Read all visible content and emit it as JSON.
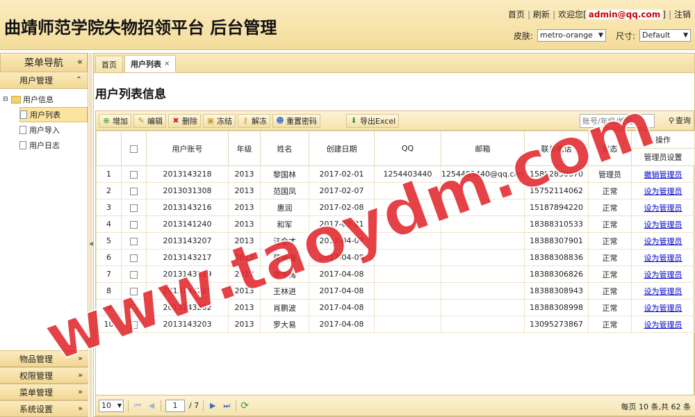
{
  "header": {
    "title": "曲靖师范学院失物招领平台 后台管理",
    "links": {
      "home": "首页",
      "refresh": "刷新",
      "welcome_prefix": "欢迎您[",
      "user": "admin@qq.com",
      "welcome_suffix": "]",
      "logout": "注销"
    },
    "skin_label": "皮肤:",
    "skin_value": "metro-orange",
    "size_label": "尺寸:",
    "size_value": "Default"
  },
  "nav": {
    "title": "菜单导航",
    "collapse_glyph": "«",
    "user_panel": "用户管理",
    "tree_root": "用户信息",
    "tree_items": [
      "用户列表",
      "用户导入",
      "用户日志"
    ],
    "other_panels": [
      "物品管理",
      "权限管理",
      "菜单管理",
      "系统设置"
    ]
  },
  "tabs": [
    {
      "label": "首页"
    },
    {
      "label": "用户列表"
    }
  ],
  "page_title": "用户列表信息",
  "toolbar": {
    "buttons": [
      "增加",
      "编辑",
      "删除",
      "冻结",
      "解冻",
      "重置密码"
    ],
    "export": "导出Excel",
    "search_placeholder": "账号/年级/姓名",
    "search": "查询"
  },
  "columns": [
    "",
    "用户账号",
    "年级",
    "姓名",
    "创建日期",
    "QQ",
    "邮箱",
    "联系电话",
    "状态"
  ],
  "op_header": "操作",
  "op_subheader": "管理员设置",
  "rows": [
    {
      "n": "1",
      "account": "2013143218",
      "grade": "2013",
      "name": "黎国林",
      "date": "2017-02-01",
      "qq": "1254403440",
      "email": "1254403440@qq.com",
      "phone": "15802850670",
      "status": "管理员",
      "op": "撤销管理员"
    },
    {
      "n": "2",
      "account": "2013031308",
      "grade": "2013",
      "name": "范国凤",
      "date": "2017-02-07",
      "qq": "",
      "email": "",
      "phone": "15752114062",
      "status": "正常",
      "op": "设为管理员"
    },
    {
      "n": "3",
      "account": "2013143216",
      "grade": "2013",
      "name": "惠润",
      "date": "2017-02-08",
      "qq": "",
      "email": "",
      "phone": "15187894220",
      "status": "正常",
      "op": "设为管理员"
    },
    {
      "n": "4",
      "account": "2013141240",
      "grade": "2013",
      "name": "和军",
      "date": "2017-03-21",
      "qq": "",
      "email": "",
      "phone": "18388310533",
      "status": "正常",
      "op": "设为管理员"
    },
    {
      "n": "5",
      "account": "2013143207",
      "grade": "2013",
      "name": "汪金才",
      "date": "2017-04-07",
      "qq": "",
      "email": "",
      "phone": "18388307901",
      "status": "正常",
      "op": "设为管理员"
    },
    {
      "n": "6",
      "account": "2013143217",
      "grade": "2013",
      "name": "蒋金海",
      "date": "2017-04-08",
      "qq": "",
      "email": "",
      "phone": "18388308836",
      "status": "正常",
      "op": "设为管理员"
    },
    {
      "n": "7",
      "account": "2013143219",
      "grade": "2013",
      "name": "李冬梅",
      "date": "2017-04-08",
      "qq": "",
      "email": "",
      "phone": "18388306826",
      "status": "正常",
      "op": "设为管理员"
    },
    {
      "n": "8",
      "account": "2013143201",
      "grade": "2013",
      "name": "王林进",
      "date": "2017-04-08",
      "qq": "",
      "email": "",
      "phone": "18388308943",
      "status": "正常",
      "op": "设为管理员"
    },
    {
      "n": "9",
      "account": "2013143202",
      "grade": "2013",
      "name": "肖鹏波",
      "date": "2017-04-08",
      "qq": "",
      "email": "",
      "phone": "18388308998",
      "status": "正常",
      "op": "设为管理员"
    },
    {
      "n": "10",
      "account": "2013143203",
      "grade": "2013",
      "name": "罗大易",
      "date": "2017-04-08",
      "qq": "",
      "email": "",
      "phone": "13095273867",
      "status": "正常",
      "op": "设为管理员"
    }
  ],
  "pager": {
    "page_size": "10",
    "current_page": "1",
    "total_pages": "/ 7",
    "info": "每页 10 条,共 62 条"
  },
  "watermark": "www.taoydm.com",
  "colors": {
    "accent": "#f4dc9a",
    "border": "#d3bd82",
    "watermark": "#e0282c",
    "link": "#0000cc"
  }
}
